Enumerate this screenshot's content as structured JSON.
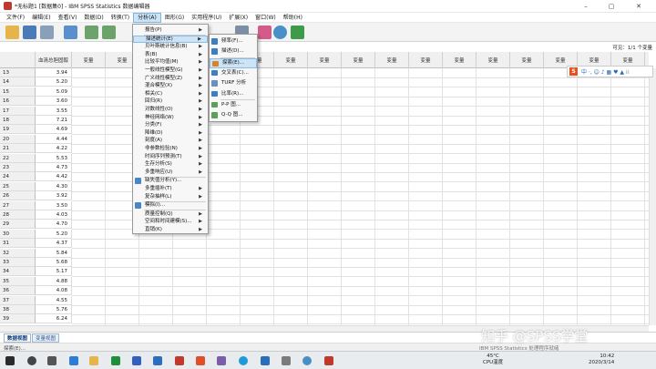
{
  "window": {
    "title": "*无标题1 [数据集0] - IBM SPSS Statistics 数据编辑器",
    "controls": [
      "–",
      "▢",
      "✕"
    ]
  },
  "menubar": {
    "items": [
      "文件(F)",
      "编辑(E)",
      "查看(V)",
      "数据(D)",
      "转换(T)",
      "分析(A)",
      "图形(G)",
      "实用程序(U)",
      "扩展(X)",
      "窗口(W)",
      "帮助(H)"
    ],
    "active_index": 5
  },
  "toolbar": {
    "icons": [
      "open-folder-icon",
      "save-icon",
      "print-icon",
      "dialog-recall-icon",
      "undo-icon",
      "redo-icon",
      "goto-case-icon",
      "goto-variable-icon",
      "variables-icon",
      "find-icon",
      "insert-cases-icon",
      "insert-variable-icon",
      "split-file-icon",
      "weight-cases-icon",
      "select-cases-icon",
      "value-labels-icon",
      "use-sets-icon"
    ]
  },
  "grid": {
    "var_count": "可见：1/1 个变量",
    "first_column_header": "血清总胆固醇",
    "empty_column_header": "变量",
    "rows": [
      {
        "n": "13",
        "v": "3.94"
      },
      {
        "n": "14",
        "v": "5.20"
      },
      {
        "n": "15",
        "v": "5.09"
      },
      {
        "n": "16",
        "v": "3.60"
      },
      {
        "n": "17",
        "v": "3.55"
      },
      {
        "n": "18",
        "v": "7.21"
      },
      {
        "n": "19",
        "v": "4.69"
      },
      {
        "n": "20",
        "v": "4.44"
      },
      {
        "n": "21",
        "v": "4.22"
      },
      {
        "n": "22",
        "v": "5.53"
      },
      {
        "n": "23",
        "v": "4.73"
      },
      {
        "n": "24",
        "v": "4.42"
      },
      {
        "n": "25",
        "v": "4.30"
      },
      {
        "n": "26",
        "v": "3.92"
      },
      {
        "n": "27",
        "v": "3.50"
      },
      {
        "n": "28",
        "v": "4.03"
      },
      {
        "n": "29",
        "v": "4.70"
      },
      {
        "n": "30",
        "v": "5.20"
      },
      {
        "n": "31",
        "v": "4.37"
      },
      {
        "n": "32",
        "v": "5.84"
      },
      {
        "n": "33",
        "v": "5.68"
      },
      {
        "n": "34",
        "v": "5.17"
      },
      {
        "n": "35",
        "v": "4.88"
      },
      {
        "n": "36",
        "v": "4.08"
      },
      {
        "n": "37",
        "v": "4.55"
      },
      {
        "n": "38",
        "v": "5.76"
      },
      {
        "n": "39",
        "v": "6.24"
      }
    ]
  },
  "analyze_menu": {
    "items": [
      {
        "label": "报告(P)",
        "sub": true
      },
      {
        "label": "描述统计(E)",
        "sub": true,
        "highlight": true
      },
      {
        "label": "贝叶斯统计信息(B)",
        "sub": true
      },
      {
        "label": "表(B)",
        "sub": true
      },
      {
        "label": "比较平均值(M)",
        "sub": true
      },
      {
        "label": "一般线性模型(G)",
        "sub": true
      },
      {
        "label": "广义线性模型(Z)",
        "sub": true
      },
      {
        "label": "混合模型(X)",
        "sub": true
      },
      {
        "label": "相关(C)",
        "sub": true
      },
      {
        "label": "回归(R)",
        "sub": true
      },
      {
        "label": "对数线性(O)",
        "sub": true
      },
      {
        "label": "神经网络(W)",
        "sub": true
      },
      {
        "label": "分类(F)",
        "sub": true
      },
      {
        "label": "降维(D)",
        "sub": true
      },
      {
        "label": "刻度(A)",
        "sub": true
      },
      {
        "label": "非参数检验(N)",
        "sub": true
      },
      {
        "label": "时间序列预测(T)",
        "sub": true
      },
      {
        "label": "生存分析(S)",
        "sub": true
      },
      {
        "label": "多重响应(U)",
        "sub": true
      },
      {
        "label": "缺失值分析(Y)...",
        "sub": false,
        "icon": true
      },
      {
        "label": "多重插补(T)",
        "sub": true
      },
      {
        "label": "复杂抽样(L)",
        "sub": true
      },
      {
        "label": "模拟(I)...",
        "sub": false,
        "icon": true
      },
      {
        "label": "质量控制(Q)",
        "sub": true
      },
      {
        "label": "空间和时间建模(S)...",
        "sub": true
      },
      {
        "label": "直销(K)",
        "sub": true
      }
    ]
  },
  "descriptives_submenu": {
    "items": [
      {
        "label": "频率(F)...",
        "icon_color": "#3c7dc4"
      },
      {
        "label": "描述(D)...",
        "icon_color": "#3c7dc4"
      },
      {
        "label": "探索(E)...",
        "icon_color": "#d9822b",
        "highlight": true
      },
      {
        "label": "交叉表(C)...",
        "icon_color": "#3c7dc4"
      },
      {
        "label": "TURF 分析",
        "icon_color": "#6a8fc7"
      },
      {
        "label": "比率(R)...",
        "icon_color": "#3c7dc4"
      },
      {
        "label": "P-P 图...",
        "icon_color": "#5aa05a"
      },
      {
        "label": "Q-Q 图...",
        "icon_color": "#5aa05a"
      }
    ]
  },
  "bottom_tabs": [
    "数据视图",
    "变量视图"
  ],
  "statusbar": {
    "left": "探索(E)...",
    "center": "IBM SPSS Statistics 处理程序就绪"
  },
  "ime": {
    "logo": "S",
    "glyphs": "中 ·, ☺ ♪ ▦ ♥ ▲ ⁞⁞"
  },
  "taskbar": {
    "weather_temp": "45°C",
    "weather_label": "CPU温度",
    "time": "10:42",
    "date": "2020/3/14"
  },
  "watermark": "知乎 @SPSS学堂",
  "colors": {
    "menu_highlight": "#cde3f6",
    "title_icon": "#c0392b",
    "tab_text": "#0a3a78"
  }
}
